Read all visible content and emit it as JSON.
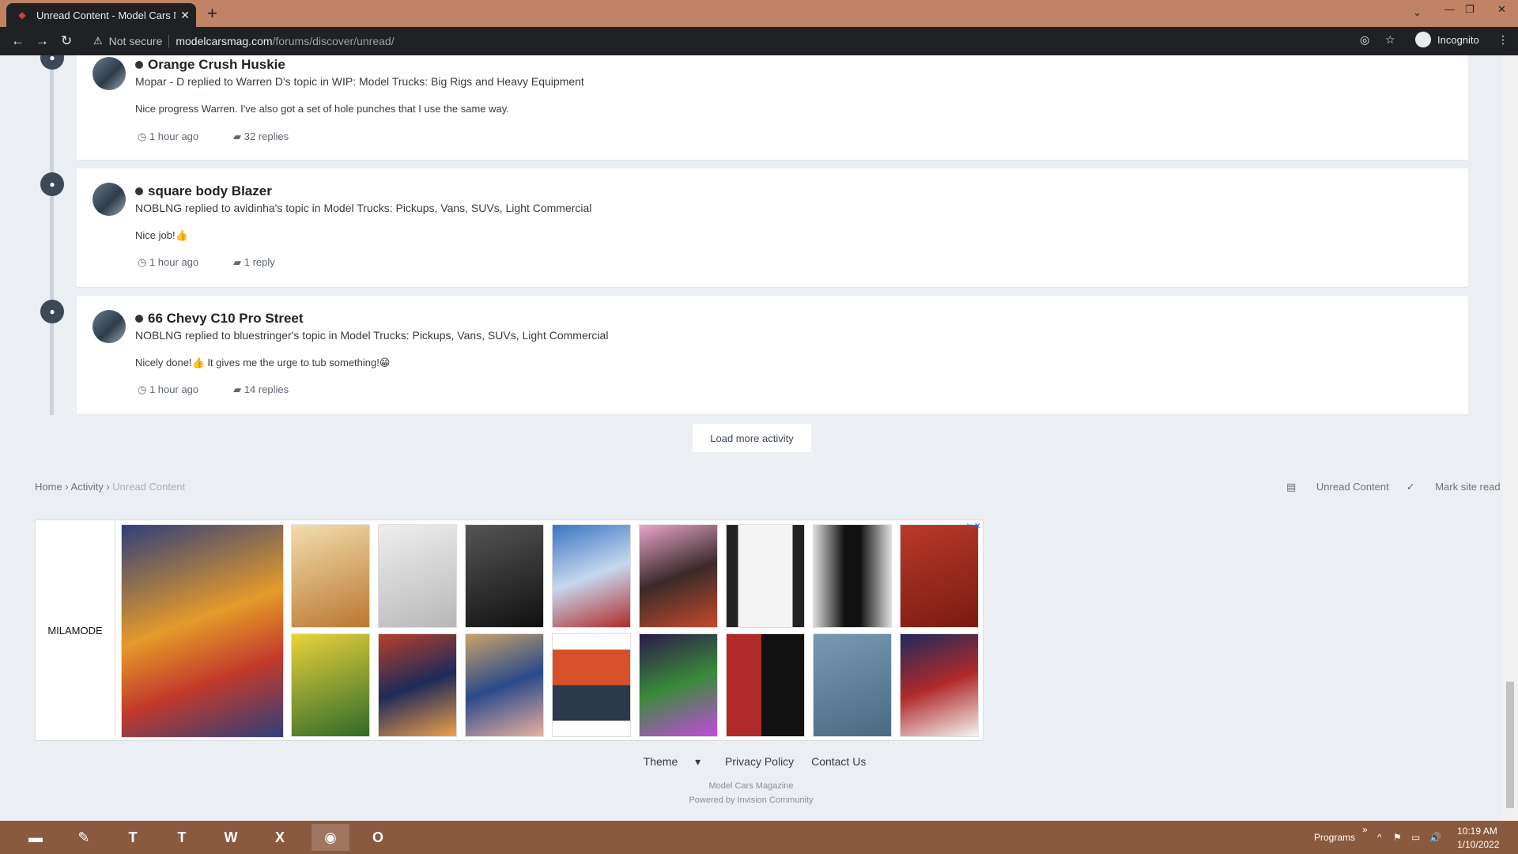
{
  "browser": {
    "tab_title": "Unread Content - Model Cars Ma",
    "security_label": "Not secure",
    "url_host": "modelcarsmag.com",
    "url_path": "/forums/discover/unread/",
    "profile_label": "Incognito"
  },
  "activity": [
    {
      "title": "Orange Crush Huskie",
      "meta": "Mopar - D replied to Warren D's topic in WIP: Model Trucks: Big Rigs and Heavy Equipment",
      "snippet": "Nice progress Warren. I've also got a set of hole punches that I use the same way.",
      "time": "1 hour ago",
      "replies": "32 replies"
    },
    {
      "title": "square body Blazer",
      "meta": "NOBLNG replied to avidinha's topic in Model Trucks: Pickups, Vans, SUVs, Light Commercial",
      "snippet": "Nice job!👍",
      "time": "1 hour ago",
      "replies": "1 reply"
    },
    {
      "title": "66 Chevy C10 Pro Street",
      "meta": "NOBLNG replied to bluestringer's topic in Model Trucks: Pickups, Vans, SUVs, Light Commercial",
      "snippet": "Nicely done!👍 It gives me the urge to tub something!😁",
      "time": "1 hour ago",
      "replies": "14 replies"
    }
  ],
  "load_more": "Load more activity",
  "breadcrumb": {
    "home": "Home",
    "activity": "Activity",
    "current": "Unread Content"
  },
  "actions": {
    "unread": "Unread Content",
    "mark_read": "Mark site read"
  },
  "ad": {
    "brand": "MILAMODE"
  },
  "footer": {
    "theme": "Theme",
    "privacy": "Privacy Policy",
    "contact": "Contact Us",
    "site": "Model Cars Magazine",
    "powered": "Powered by Invision Community"
  },
  "taskbar": {
    "programs": "Programs",
    "time": "10:19 AM",
    "date": "1/10/2022"
  }
}
